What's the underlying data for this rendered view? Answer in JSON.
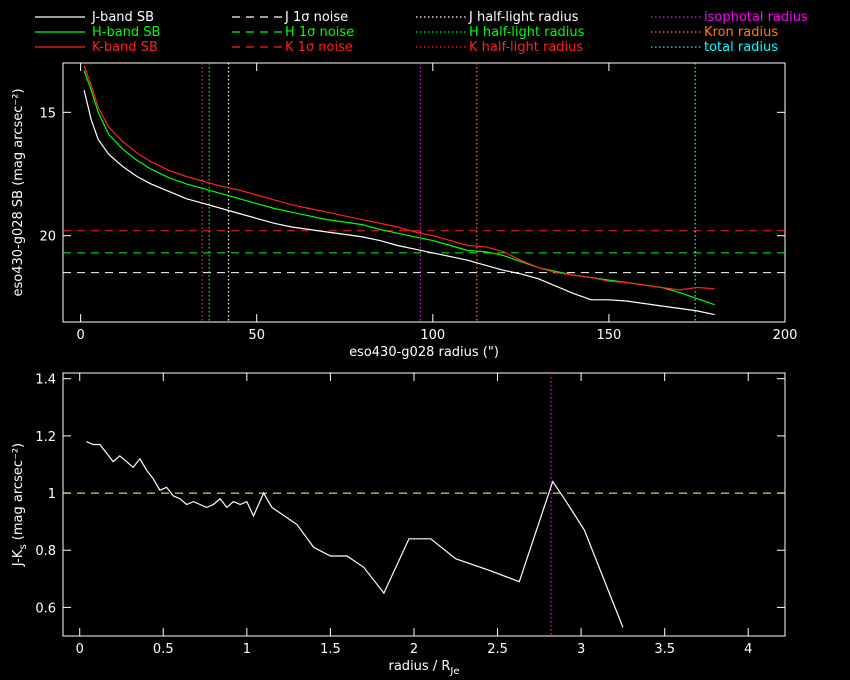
{
  "legend": [
    {
      "label": "J-band SB",
      "color": "#ffffff",
      "dash": "solid"
    },
    {
      "label": "H-band SB",
      "color": "#00ff00",
      "dash": "solid"
    },
    {
      "label": "K-band SB",
      "color": "#ff2020",
      "dash": "solid"
    },
    {
      "label": "J 1σ noise",
      "color": "#ffffff",
      "dash": "dashed"
    },
    {
      "label": "H 1σ noise",
      "color": "#00ff00",
      "dash": "dashed"
    },
    {
      "label": "K 1σ noise",
      "color": "#ff2020",
      "dash": "dashed"
    },
    {
      "label": "J half-light radius",
      "color": "#ffffff",
      "dash": "dotted"
    },
    {
      "label": "H half-light radius",
      "color": "#00ff00",
      "dash": "dotted"
    },
    {
      "label": "K half-light radius",
      "color": "#ff2020",
      "dash": "dotted"
    },
    {
      "label": "isophotal radius",
      "color": "#ff00ff",
      "dash": "dotted"
    },
    {
      "label": "Kron radius",
      "color": "#ff8000",
      "dash": "dotted"
    },
    {
      "label": "total radius",
      "color": "#00ffff",
      "dash": "dotted"
    }
  ],
  "chart_data": [
    {
      "type": "line",
      "xlabel": "eso430-g028 radius (\")",
      "ylabel": "eso430-g028 SB (mag arcsec⁻²)",
      "xlim": [
        -5,
        200
      ],
      "ylim": [
        23.5,
        13.0
      ],
      "y_inverted": true,
      "xticks": [
        0,
        50,
        100,
        150,
        200
      ],
      "yticks": [
        15,
        20
      ],
      "series": [
        {
          "name": "J-band SB",
          "color": "#ffffff",
          "x": [
            1,
            3,
            5,
            8,
            12,
            16,
            20,
            25,
            30,
            35,
            40,
            45,
            50,
            55,
            60,
            65,
            70,
            75,
            80,
            85,
            90,
            95,
            100,
            105,
            110,
            115,
            120,
            125,
            130,
            135,
            140,
            145,
            150,
            155,
            160,
            165,
            170,
            175,
            180
          ],
          "y": [
            14.1,
            15.3,
            16.1,
            16.7,
            17.2,
            17.6,
            17.9,
            18.2,
            18.5,
            18.7,
            18.9,
            19.1,
            19.3,
            19.5,
            19.65,
            19.75,
            19.85,
            19.95,
            20.05,
            20.2,
            20.4,
            20.55,
            20.7,
            20.85,
            21.0,
            21.2,
            21.4,
            21.55,
            21.75,
            22.05,
            22.35,
            22.6,
            22.6,
            22.65,
            22.75,
            22.85,
            22.95,
            23.05,
            23.2
          ]
        },
        {
          "name": "H-band SB",
          "color": "#00ff00",
          "x": [
            1,
            3,
            5,
            8,
            12,
            16,
            20,
            25,
            30,
            35,
            40,
            45,
            50,
            55,
            60,
            65,
            70,
            75,
            80,
            85,
            90,
            95,
            100,
            105,
            110,
            115,
            120,
            125,
            130,
            135,
            140,
            145,
            150,
            155,
            160,
            165,
            170,
            175,
            180
          ],
          "y": [
            13.3,
            14.1,
            15.0,
            15.9,
            16.5,
            16.95,
            17.3,
            17.65,
            17.9,
            18.1,
            18.3,
            18.5,
            18.7,
            18.9,
            19.05,
            19.2,
            19.35,
            19.45,
            19.55,
            19.75,
            19.9,
            20.05,
            20.2,
            20.4,
            20.6,
            20.65,
            20.8,
            21.05,
            21.3,
            21.45,
            21.6,
            21.7,
            21.8,
            21.9,
            22.0,
            22.1,
            22.3,
            22.55,
            22.8
          ]
        },
        {
          "name": "K-band SB",
          "color": "#ff2020",
          "x": [
            1,
            3,
            5,
            8,
            12,
            16,
            20,
            25,
            30,
            35,
            40,
            45,
            50,
            55,
            60,
            65,
            70,
            75,
            80,
            85,
            90,
            95,
            100,
            105,
            110,
            115,
            120,
            125,
            130,
            135,
            140,
            145,
            150,
            155,
            160,
            165,
            170,
            175,
            180
          ],
          "y": [
            13.1,
            13.9,
            14.8,
            15.6,
            16.2,
            16.65,
            17.0,
            17.35,
            17.6,
            17.8,
            18.0,
            18.15,
            18.35,
            18.55,
            18.75,
            18.9,
            19.05,
            19.2,
            19.35,
            19.5,
            19.65,
            19.85,
            20.0,
            20.2,
            20.4,
            20.45,
            20.65,
            21.0,
            21.3,
            21.5,
            21.6,
            21.7,
            21.85,
            21.9,
            22.0,
            22.1,
            22.2,
            22.1,
            22.15
          ]
        }
      ],
      "hlines": [
        {
          "y": 21.5,
          "color": "#ffffff",
          "dash": "dashed"
        },
        {
          "y": 20.7,
          "color": "#00ff00",
          "dash": "dashed"
        },
        {
          "y": 19.8,
          "color": "#ff2020",
          "dash": "dashed"
        }
      ],
      "vlines": [
        {
          "x": 42,
          "color": "#ffffff",
          "dash": "dotted"
        },
        {
          "x": 36.5,
          "color": "#00ff00",
          "dash": "dotted"
        },
        {
          "x": 34.5,
          "color": "#ff2020",
          "dash": "dotted"
        },
        {
          "x": 96.5,
          "color": "#ff00ff",
          "dash": "dotted"
        },
        {
          "x": 112.5,
          "color": "#ff8000",
          "dash": "dotted"
        },
        {
          "x": 174.5,
          "color": "#00ffff",
          "dash": "dotted"
        }
      ]
    },
    {
      "type": "line",
      "xlabel": "radius / R",
      "xlabel_sub": "Je",
      "ylabel": "J-K",
      "ylabel_sub": "s",
      "ylabel_rest": " (mag arcsec⁻²)",
      "xlim": [
        -0.1,
        4.22
      ],
      "ylim": [
        0.5,
        1.42
      ],
      "xticks": [
        0,
        0.5,
        1,
        1.5,
        2,
        2.5,
        3,
        3.5,
        4
      ],
      "xticklabels": [
        "0",
        "0.5",
        "1",
        "1.5",
        "2",
        "2.5",
        "3",
        "3.5",
        "4"
      ],
      "yticks": [
        0.6,
        0.8,
        1,
        1.2,
        1.4
      ],
      "yticklabels": [
        "0.6",
        "0.8",
        "1",
        "1.2",
        "1.4"
      ],
      "series": [
        {
          "name": "",
          "color": "#ffffff",
          "x": [
            0.04,
            0.08,
            0.12,
            0.16,
            0.2,
            0.24,
            0.28,
            0.32,
            0.36,
            0.4,
            0.44,
            0.48,
            0.52,
            0.56,
            0.6,
            0.64,
            0.68,
            0.72,
            0.76,
            0.8,
            0.84,
            0.88,
            0.92,
            0.96,
            1.0,
            1.04,
            1.1,
            1.15,
            1.2,
            1.3,
            1.4,
            1.5,
            1.6,
            1.7,
            1.82,
            1.97,
            2.1,
            2.25,
            2.45,
            2.63,
            2.83,
            2.9,
            3.02,
            3.25
          ],
          "y": [
            1.18,
            1.17,
            1.17,
            1.14,
            1.11,
            1.13,
            1.11,
            1.09,
            1.12,
            1.08,
            1.05,
            1.01,
            1.02,
            0.99,
            0.98,
            0.96,
            0.97,
            0.96,
            0.95,
            0.96,
            0.98,
            0.95,
            0.97,
            0.96,
            0.97,
            0.92,
            1.0,
            0.95,
            0.93,
            0.89,
            0.81,
            0.78,
            0.78,
            0.74,
            0.65,
            0.84,
            0.84,
            0.77,
            0.73,
            0.69,
            1.04,
            0.98,
            0.87,
            0.53
          ]
        }
      ],
      "hlines": [
        {
          "y": 1.0,
          "color": "#ffff99",
          "dash": "dashed"
        }
      ],
      "vlines": [
        {
          "x": 2.82,
          "color": "#ff00ff",
          "dash": "dotted"
        }
      ]
    }
  ]
}
